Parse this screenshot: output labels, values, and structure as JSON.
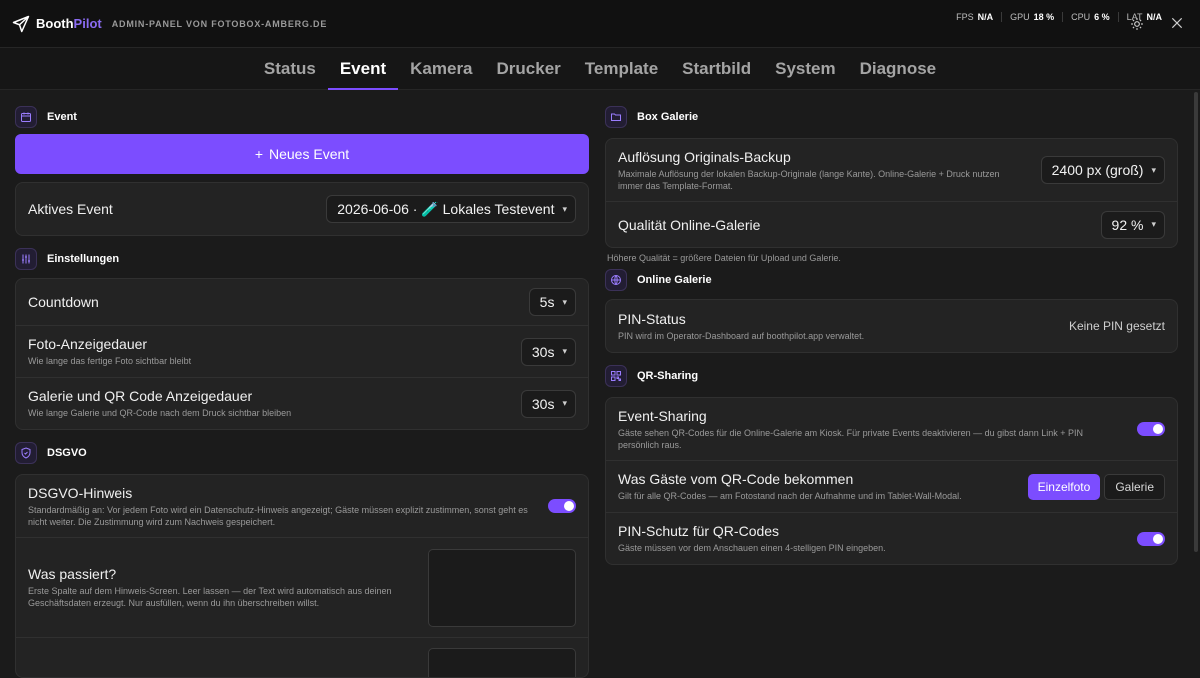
{
  "header": {
    "brand_main": "Booth",
    "brand_accent": "Pilot",
    "subtitle": "ADMIN-PANEL VON FOTOBOX-AMBERG.DE",
    "metrics": [
      {
        "label": "FPS",
        "value": "N/A"
      },
      {
        "label": "GPU",
        "value": "18 %"
      },
      {
        "label": "CPU",
        "value": "6 %"
      },
      {
        "label": "LAT",
        "value": "N/A"
      }
    ]
  },
  "tabs": [
    "Status",
    "Event",
    "Kamera",
    "Drucker",
    "Template",
    "Startbild",
    "System",
    "Diagnose"
  ],
  "active_tab": "Event",
  "event": {
    "title": "Event",
    "new_button": "Neues Event",
    "active_label": "Aktives Event",
    "active_value": "2026-06-06 · 🧪 Lokales Testevent"
  },
  "settings": {
    "title": "Einstellungen",
    "rows": [
      {
        "title": "Countdown",
        "desc": "",
        "value": "5s"
      },
      {
        "title": "Foto-Anzeigedauer",
        "desc": "Wie lange das fertige Foto sichtbar bleibt",
        "value": "30s"
      },
      {
        "title": "Galerie und QR Code Anzeigedauer",
        "desc": "Wie lange Galerie und QR-Code nach dem Druck sichtbar bleiben",
        "value": "30s"
      }
    ]
  },
  "dsgvo": {
    "title": "DSGVO",
    "hint_title": "DSGVO-Hinweis",
    "hint_desc": "Standardmäßig an: Vor jedem Foto wird ein Datenschutz-Hinweis angezeigt; Gäste müssen explizit zustimmen, sonst geht es nicht weiter. Die Zustimmung wird zum Nachweis gespeichert.",
    "what_title": "Was passiert?",
    "what_desc": "Erste Spalte auf dem Hinweis-Screen. Leer lassen — der Text wird automatisch aus deinen Geschäftsdaten erzeugt. Nur ausfüllen, wenn du ihn überschreiben willst."
  },
  "box_gallery": {
    "title": "Box Galerie",
    "res_title": "Auflösung Originals-Backup",
    "res_desc": "Maximale Auflösung der lokalen Backup-Originale (lange Kante). Online-Galerie + Druck nutzen immer das Template-Format.",
    "res_value": "2400 px (groß)",
    "quality_title": "Qualität Online-Galerie",
    "quality_value": "92 %",
    "hint": "Höhere Qualität = größere Dateien für Upload und Galerie."
  },
  "online_gallery": {
    "title": "Online Galerie",
    "pin_title": "PIN-Status",
    "pin_desc": "PIN wird im Operator-Dashboard auf boothpilot.app verwaltet.",
    "pin_value": "Keine PIN gesetzt"
  },
  "qr_sharing": {
    "title": "QR-Sharing",
    "share_title": "Event-Sharing",
    "share_desc": "Gäste sehen QR-Codes für die Online-Galerie am Kiosk. Für private Events deaktivieren — du gibst dann Link + PIN persönlich raus.",
    "what_title": "Was Gäste vom QR-Code bekommen",
    "what_desc": "Gilt für alle QR-Codes — am Fotostand nach der Aufnahme und im Tablet-Wall-Modal.",
    "option_single": "Einzelfoto",
    "option_gallery": "Galerie",
    "pin_title": "PIN-Schutz für QR-Codes",
    "pin_desc": "Gäste müssen vor dem Anschauen einen 4-stelligen PIN eingeben."
  },
  "colors": {
    "accent": "#7c4dff",
    "background": "#1b1b1b",
    "card": "#232323"
  }
}
